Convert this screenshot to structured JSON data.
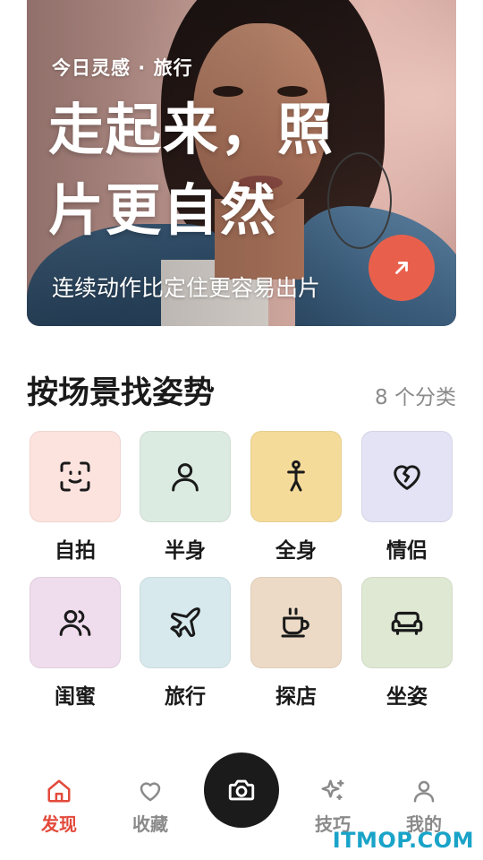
{
  "hero": {
    "kicker": "今日灵感 · 旅行",
    "title": "走起来，照片更自然",
    "subtitle": "连续动作比定住更容易出片",
    "action_icon": "arrow-up-right-icon",
    "action_color": "#e8604c"
  },
  "section": {
    "title": "按场景找姿势",
    "count": "8 个分类"
  },
  "categories": [
    {
      "label": "自拍",
      "icon": "face-scan-icon",
      "bg": "#fde3de"
    },
    {
      "label": "半身",
      "icon": "person-bust-icon",
      "bg": "#dcebe1"
    },
    {
      "label": "全身",
      "icon": "standing-figure-icon",
      "bg": "#f5db9a"
    },
    {
      "label": "情侣",
      "icon": "heart-icon",
      "bg": "#e3e3f5"
    },
    {
      "label": "闺蜜",
      "icon": "two-people-icon",
      "bg": "#efdcec"
    },
    {
      "label": "旅行",
      "icon": "airplane-icon",
      "bg": "#d7e9ed"
    },
    {
      "label": "探店",
      "icon": "coffee-cup-icon",
      "bg": "#ecdac6"
    },
    {
      "label": "坐姿",
      "icon": "sofa-icon",
      "bg": "#dfe8d3"
    }
  ],
  "nav": {
    "items": [
      {
        "label": "发现",
        "icon": "home-icon",
        "active": true
      },
      {
        "label": "收藏",
        "icon": "heart-outline-icon",
        "active": false
      },
      {
        "label": "技巧",
        "icon": "sparkle-icon",
        "active": false
      },
      {
        "label": "我的",
        "icon": "user-icon",
        "active": false
      }
    ],
    "camera_icon": "camera-icon",
    "active_color": "#e24a3b"
  },
  "watermark": "ITMOP.COM"
}
